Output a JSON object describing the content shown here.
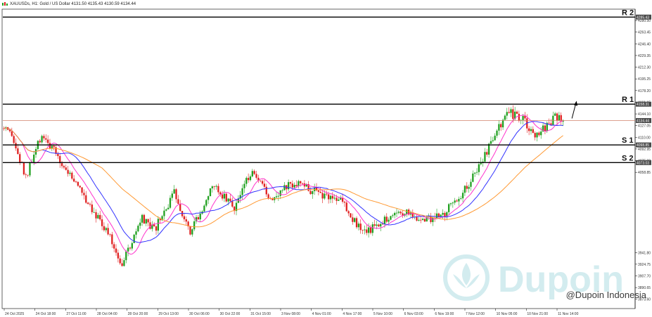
{
  "header": {
    "symbol_line": "XAUUSDs, H1:  Gold / US Dollar  4131.50 4135.43 4130.59 4134.44"
  },
  "watermark": {
    "brand": "Dupoin",
    "social": "@Dupoin Indonesia"
  },
  "colors": {
    "bull": "#1fa01f",
    "bear": "#e01f1f",
    "ma_fast": "#ff33cc",
    "ma_mid": "#3333ff",
    "ma_slow": "#ff9933",
    "price_line": "#d0806a",
    "level_line": "#000000",
    "trend_arrow": "#000000",
    "watermark": "#d3ecef"
  },
  "chart_data": {
    "type": "candlestick",
    "symbol": "XAUUSDs",
    "timeframe": "H1",
    "ylim": [
      3860,
      4296
    ],
    "y_ticks": [
      4280.5,
      4263.45,
      4246.4,
      4229.35,
      4212.3,
      4195.25,
      4178.2,
      4161.15,
      4144.1,
      4127.05,
      4110.0,
      4092.95,
      4075.9,
      4058.85,
      3941.8,
      3924.75,
      3907.7,
      3890.65,
      3873.6
    ],
    "y_tick_labels": [
      "4280.50",
      "4263.45",
      "4246.40",
      "4229.35",
      "4212.30",
      "4195.25",
      "4178.20",
      "4161.15",
      "4144.10",
      "4127.05",
      "4110.00",
      "4092.95",
      "4075.90",
      "4058.85",
      "3941.80",
      "3924.75",
      "3907.70",
      "3890.65",
      "3873.60"
    ],
    "x_tick_labels": [
      "24 Oct 2025",
      "24 Oct 18:00",
      "27 Oct 11:00",
      "28 Oct 04:00",
      "28 Oct 20:00",
      "29 Oct 13:00",
      "30 Oct 06:00",
      "30 Oct 22:00",
      "31 Oct 15:00",
      "3 Nov 08:00",
      "4 Nov 01:00",
      "4 Nov 17:00",
      "5 Nov 10:00",
      "6 Nov 03:00",
      "6 Nov 19:00",
      "7 Nov 12:00",
      "10 Nov 05:00",
      "10 Nov 21:00",
      "11 Nov 14:00"
    ],
    "last_price": 4134.44,
    "levels": [
      {
        "name": "R 2",
        "value": 4285.43,
        "tag": "4285.43"
      },
      {
        "name": "R 1",
        "value": 4158.31,
        "tag": "4158.31"
      },
      {
        "name": "S 1",
        "value": 4098.85,
        "tag": "4098.85"
      },
      {
        "name": "S 2",
        "value": 4073.03,
        "tag": "4073.03"
      }
    ],
    "path": [
      [
        0,
        4123
      ],
      [
        5,
        4110
      ],
      [
        12,
        4050
      ],
      [
        20,
        4115
      ],
      [
        28,
        4080
      ],
      [
        40,
        4030
      ],
      [
        52,
        3975
      ],
      [
        60,
        3925
      ],
      [
        70,
        3990
      ],
      [
        76,
        3973
      ],
      [
        86,
        4028
      ],
      [
        94,
        3975
      ],
      [
        106,
        4040
      ],
      [
        116,
        4008
      ],
      [
        124,
        4058
      ],
      [
        134,
        4022
      ],
      [
        146,
        4045
      ],
      [
        156,
        4030
      ],
      [
        170,
        4018
      ],
      [
        180,
        3968
      ],
      [
        190,
        3990
      ],
      [
        200,
        4002
      ],
      [
        210,
        3988
      ],
      [
        220,
        3997
      ],
      [
        232,
        4038
      ],
      [
        242,
        4090
      ],
      [
        252,
        4147
      ],
      [
        260,
        4135
      ],
      [
        266,
        4110
      ],
      [
        276,
        4138
      ]
    ],
    "candle_count": 280,
    "ma_periods": [
      10,
      20,
      50
    ]
  }
}
